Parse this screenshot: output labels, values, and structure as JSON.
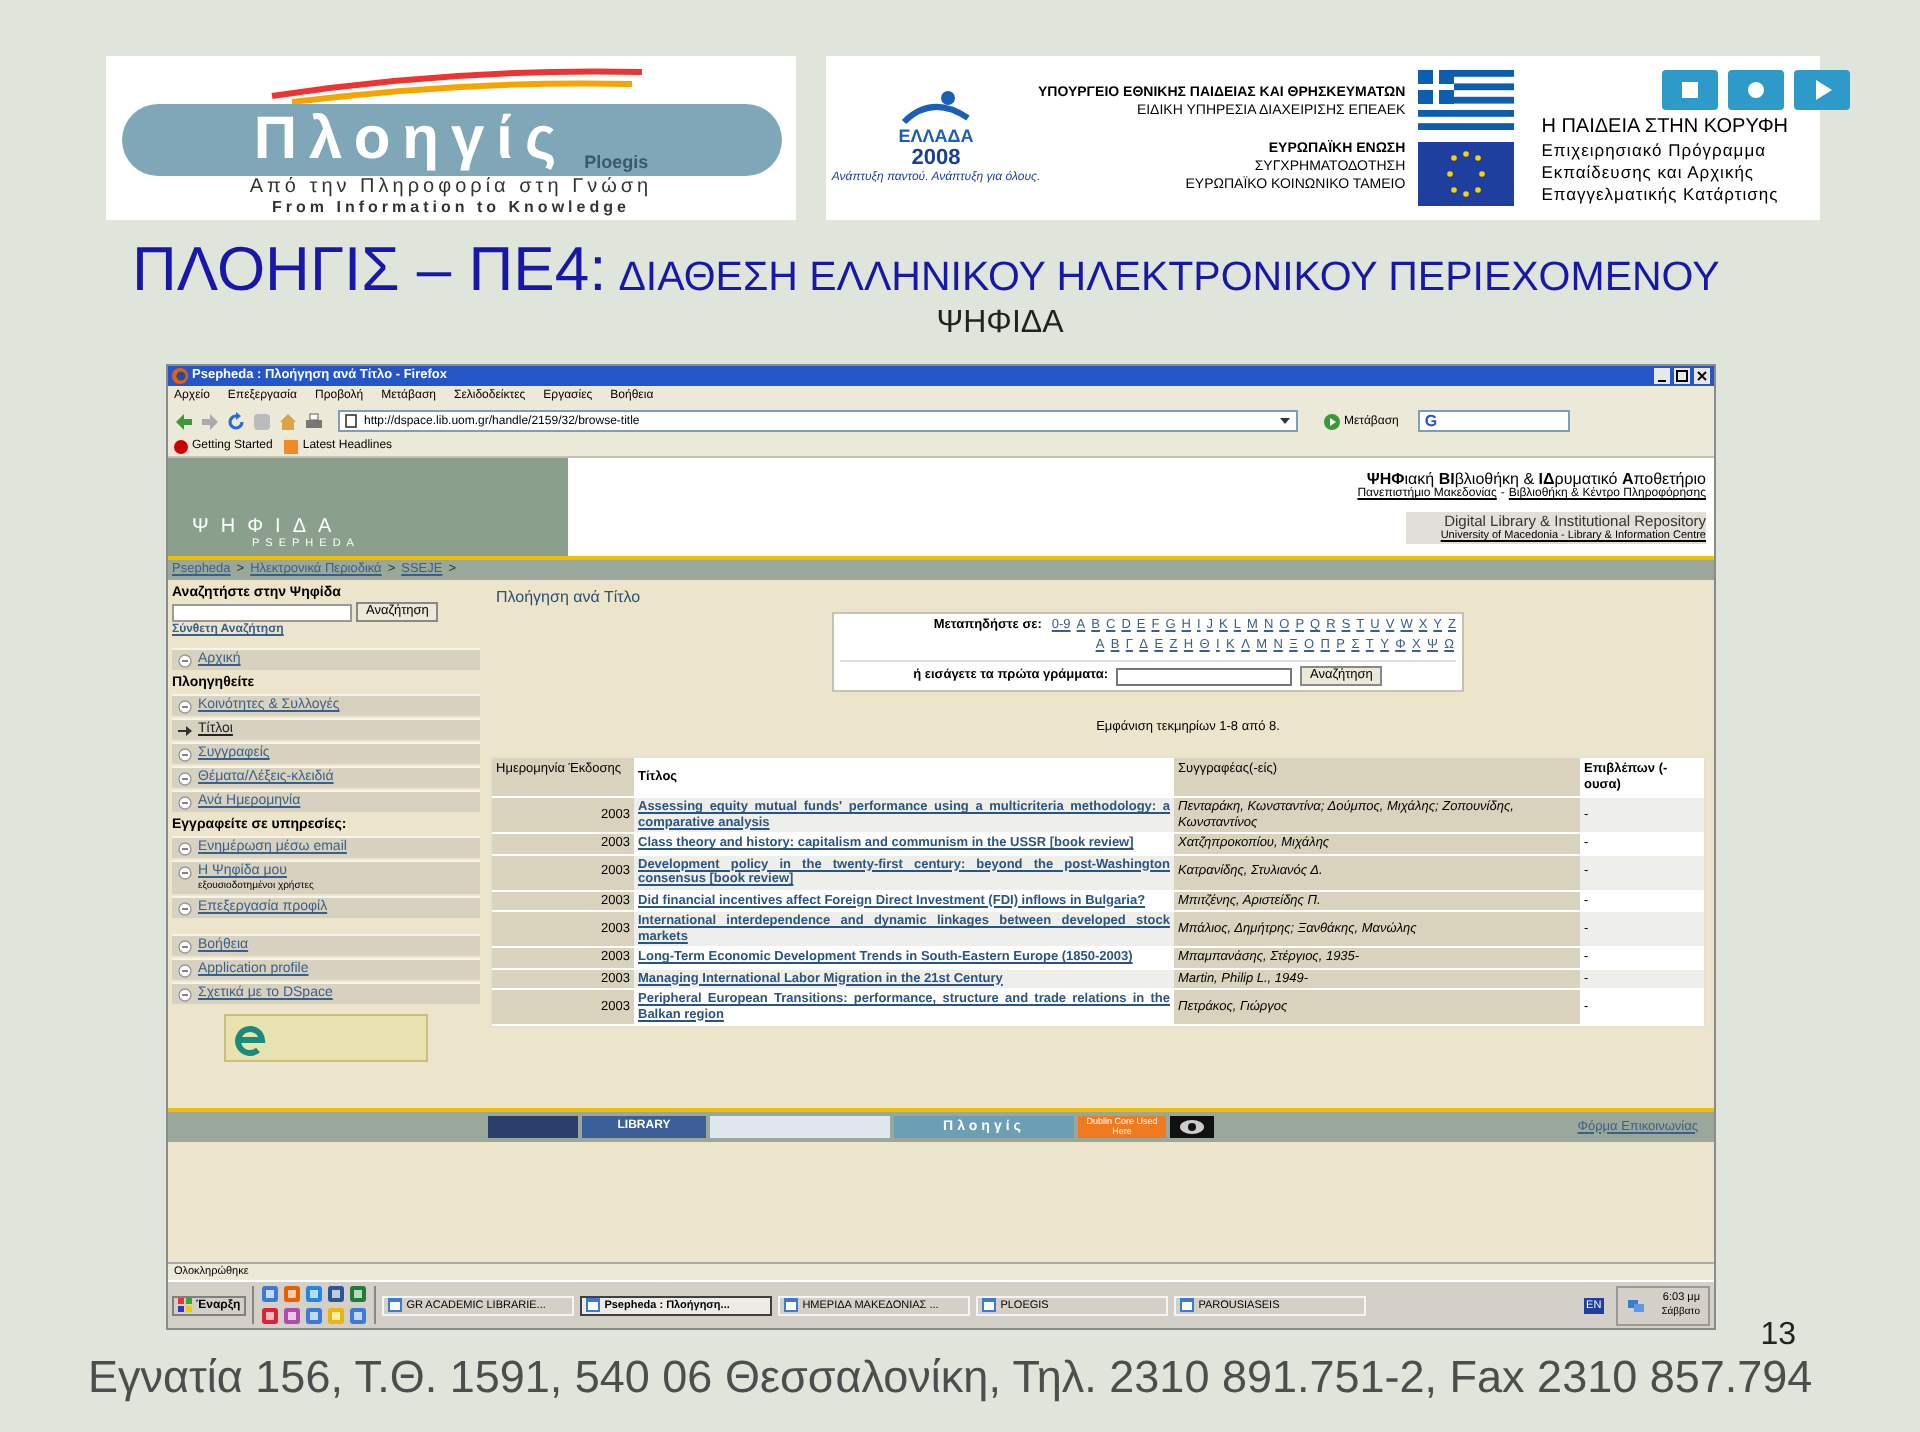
{
  "logos": {
    "ploegis": {
      "name": "Πλοηγίς",
      "latin": "Ploegis",
      "tagline": "Από την Πληροφορία στη Γνώση",
      "tagline_en": "From Information to Knowledge"
    },
    "sponsors": {
      "olympic_mark": "ΕΛΛΑΔΑ",
      "olympic_year": "2008",
      "motto": "Ανάπτυξη παντού. Ανάπτυξη για όλους.",
      "ministry": "ΥΠΟΥΡΓΕΙΟ ΕΘΝΙΚΗΣ ΠΑΙΔΕΙΑΣ ΚΑΙ ΘΡΗΣΚΕΥΜΑΤΩΝ",
      "service": "ΕΙΔΙΚΗ ΥΠΗΡΕΣΙΑ ΔΙΑΧΕΙΡΙΣΗΣ ΕΠΕΑΕΚ",
      "eu": "ΕΥΡΩΠΑΪΚΗ ΕΝΩΣΗ",
      "cofunding": "ΣΥΓΧΡΗΜΑΤΟΔΟΤΗΣΗ",
      "fund": "ΕΥΡΩΠΑΪΚΟ ΚΟΙΝΩΝΙΚΟ ΤΑΜΕΙΟ",
      "program_title": "Η ΠΑΙΔΕΙΑ ΣΤΗΝ ΚΟΡΥΦΗ",
      "program_lines": [
        "Επιχειρησιακό Πρόγραμμα",
        "Εκπαίδευσης και Αρχικής",
        "Επαγγελματικής Κατάρτισης"
      ]
    }
  },
  "slide": {
    "title_main": "ΠΛΟΗΓΙΣ – ΠΕ4:",
    "title_rest": "ΔΙΑΘΕΣΗ ΕΛΛΗΝΙΚΟΥ ΗΛΕΚΤΡΟΝΙΚΟΥ ΠΕΡΙΕΧΟΜΕΝΟΥ",
    "subtitle": "ΨΗΦΙΔΑ",
    "number": "13",
    "footer": "Εγνατία 156, Τ.Θ. 1591, 540 06 Θεσσαλονίκη, Τηλ. 2310 891.751-2, Fax  2310 857.794"
  },
  "browser": {
    "title": "Psepheda : Πλοήγηση ανά Τίτλο - Firefox",
    "menu": [
      "Αρχείο",
      "Επεξεργασία",
      "Προβολή",
      "Μετάβαση",
      "Σελιδοδείκτες",
      "Εργασίες",
      "Βοήθεια"
    ],
    "url": "http://dspace.lib.uom.gr/handle/2159/32/browse-title",
    "go": "Μετάβαση",
    "search_letter": "G",
    "bookmarks": [
      "Getting Started",
      "Latest Headlines"
    ],
    "status": "Ολοκληρώθηκε"
  },
  "site": {
    "banner": {
      "name": "ΨΗΦΙΔΑ",
      "name_latin": "PSEPHEDA",
      "tagline": "**ΨΗΦ**ιακή **ΒΙ**βλιοθήκη & **ΙΔ**ρυματικό **Α**ποθετήριο",
      "links": [
        "Πανεπιστήμιο Μακεδονίας",
        "Βιβλιοθήκη & Κέντρο Πληροφόρησης"
      ],
      "link_separator": "-",
      "tagline_en": "Digital Library & Institutional Repository",
      "institution_en": "University of Macedonia - Library & Information Centre"
    },
    "breadcrumb": [
      {
        "label": "Psepheda",
        "separator": ">"
      },
      {
        "label": "Ηλεκτρονικά Περιοδικά",
        "separator": ">"
      },
      {
        "label": "SSEJE",
        "separator": ">"
      }
    ],
    "sidebar": {
      "search_heading": "Αναζητήστε στην Ψηφίδα",
      "search_button": "Αναζήτηση",
      "advanced": "Σύνθετη Αναζήτηση",
      "items": [
        {
          "kind": "item",
          "label": "Αρχική",
          "selected": false
        },
        {
          "kind": "heading",
          "label": "Πλοηγηθείτε"
        },
        {
          "kind": "item",
          "label": "Κοινότητες & Συλλογές",
          "selected": false
        },
        {
          "kind": "item",
          "label": "Τίτλοι",
          "selected": true
        },
        {
          "kind": "item",
          "label": "Συγγραφείς",
          "selected": false
        },
        {
          "kind": "item",
          "label": "Θέματα/Λέξεις-κλειδιά",
          "selected": false
        },
        {
          "kind": "item",
          "label": "Ανά Ημερομηνία",
          "selected": false
        },
        {
          "kind": "heading",
          "label": "Εγγραφείτε σε υπηρεσίες:"
        },
        {
          "kind": "item",
          "label": "Ενημέρωση μέσω email",
          "selected": false
        },
        {
          "kind": "item",
          "label": "Η Ψηφίδα μου",
          "note": "εξουσιοδοτημένοι χρήστες",
          "selected": false
        },
        {
          "kind": "item",
          "label": "Επεξεργασία προφίλ",
          "selected": false
        }
      ],
      "help_items": [
        {
          "label": "Βοήθεια",
          "selected": false
        },
        {
          "label": "Application profile",
          "selected": false
        },
        {
          "label": "Σχετικά με το DSpace",
          "selected": false
        }
      ]
    },
    "main": {
      "heading": "Πλοήγηση ανά Τίτλο",
      "jump_label": "Μεταπηδήστε σε:",
      "latin_letters": [
        "0-9",
        "A",
        "B",
        "C",
        "D",
        "E",
        "F",
        "G",
        "H",
        "I",
        "J",
        "K",
        "L",
        "M",
        "N",
        "O",
        "P",
        "Q",
        "R",
        "S",
        "T",
        "U",
        "V",
        "W",
        "X",
        "Y",
        "Z"
      ],
      "greek_letters": [
        "Α",
        "Β",
        "Γ",
        "Δ",
        "Ε",
        "Ζ",
        "Η",
        "Θ",
        "Ι",
        "Κ",
        "Λ",
        "Μ",
        "Ν",
        "Ξ",
        "Ο",
        "Π",
        "Ρ",
        "Σ",
        "Τ",
        "Υ",
        "Φ",
        "Χ",
        "Ψ",
        "Ω"
      ],
      "input_label": "ή εισάγετε τα πρώτα γράμματα:",
      "button": "Αναζήτηση",
      "results": "Εμφάνιση τεκμηρίων 1-8 από 8.",
      "table": {
        "columns": [
          "Ημερομηνία Έκδοσης",
          "Τίτλος",
          "Συγγραφέας(-είς)",
          "Επιβλέπων (-ουσα)"
        ],
        "rows": [
          {
            "date": "2003",
            "title": "Assessing equity mutual funds' performance using a multicriteria methodology: a comparative analysis",
            "authors": "Πενταράκη, Κωνσταντίνα; Δούμπος, Μιχάλης; Ζοπουνίδης, Κωνσταντίνος",
            "supervisor": "-"
          },
          {
            "date": "2003",
            "title": "Class theory and history: capitalism and communism in the USSR [book review]",
            "authors": "Χατζηπροκοπίου, Μιχάλης",
            "supervisor": "-"
          },
          {
            "date": "2003",
            "title": "Development policy in the twenty-first century: beyond the post-Washington consensus [book review]",
            "authors": "Κατρανίδης, Στυλιανός Δ.",
            "supervisor": "-"
          },
          {
            "date": "2003",
            "title": "Did financial incentives affect Foreign Direct Investment (FDI) inflows in Bulgaria?",
            "authors": "Μπιτζένης, Αριστείδης Π.",
            "supervisor": "-"
          },
          {
            "date": "2003",
            "title": "International interdependence and dynamic linkages between developed stock markets",
            "authors": "Μπάλιος, Δημήτρης; Ξανθάκης, Μανώλης",
            "supervisor": "-"
          },
          {
            "date": "2003",
            "title": "Long-Term Economic Development Trends in South-Eastern Europe (1850-2003)",
            "authors": "Μπαμπανάσης, Στέργιος, 1935-",
            "supervisor": "-"
          },
          {
            "date": "2003",
            "title": "Managing International Labor Migration in the 21st Century",
            "authors": "Martin, Philip L., 1949-",
            "supervisor": "-"
          },
          {
            "date": "2003",
            "title": "Peripheral European Transitions: performance, structure and trade relations in the Balkan region",
            "authors": "Πετράκος, Γιώργος",
            "supervisor": "-"
          }
        ]
      }
    },
    "footer": {
      "partners": [
        "LIBRARY",
        "Πλοηγίς",
        "Dublin Core Used Here"
      ],
      "contact": "Φόρμα Επικοινωνίας"
    }
  },
  "taskbar": {
    "start": "Έναρξη",
    "tasks": [
      {
        "label": "GR ACADEMIC LIBRARIE...",
        "selected": false
      },
      {
        "label": "Psepheda : Πλοήγηση...",
        "selected": true
      },
      {
        "label": "ΗΜΕΡΙΔΑ ΜΑΚΕΔΟΝΙΑΣ ...",
        "selected": false
      },
      {
        "label": "PLOEGIS",
        "selected": false
      },
      {
        "label": "PAROUSIASEIS",
        "selected": false
      }
    ],
    "language": "EN",
    "time": "6:03 μμ",
    "day": "Σάββατο"
  }
}
